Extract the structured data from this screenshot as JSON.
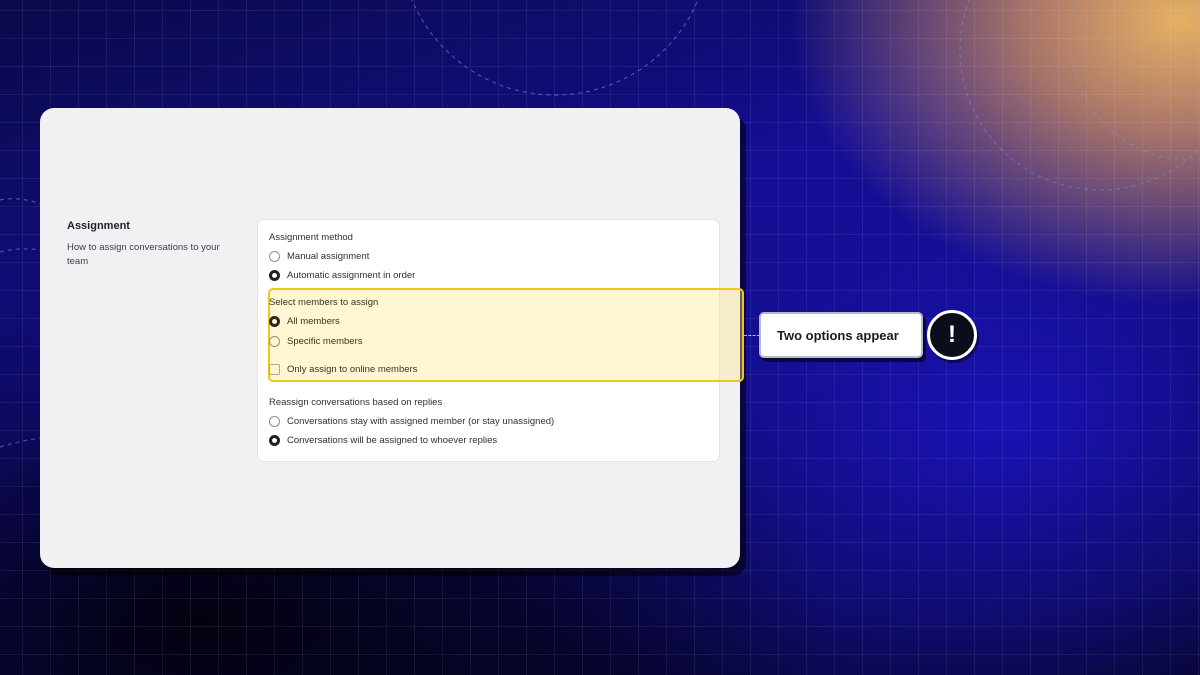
{
  "assignment": {
    "title": "Assignment",
    "description": "How to assign conversations to your team"
  },
  "method": {
    "label": "Assignment method",
    "options": [
      {
        "label": "Manual assignment",
        "selected": false
      },
      {
        "label": "Automatic assignment in order",
        "selected": true
      }
    ]
  },
  "members": {
    "label": "Select members to assign",
    "options": [
      {
        "label": "All members",
        "selected": true
      },
      {
        "label": "Specific members",
        "selected": false
      }
    ],
    "online_only": {
      "label": "Only assign to online members",
      "checked": false
    }
  },
  "reassign": {
    "label": "Reassign conversations based on replies",
    "options": [
      {
        "label": "Conversations stay with assigned member (or stay unassigned)",
        "selected": false
      },
      {
        "label": "Conversations will be assigned to whoever replies",
        "selected": true
      }
    ]
  },
  "callout": {
    "text": "Two options appear",
    "icon": "exclamation-icon",
    "icon_glyph": "!"
  },
  "colors": {
    "highlight_border": "#f1c61c",
    "highlight_fill": "#fff3c4",
    "accent_gold": "#e6b063",
    "background_blue": "#130d8c"
  }
}
